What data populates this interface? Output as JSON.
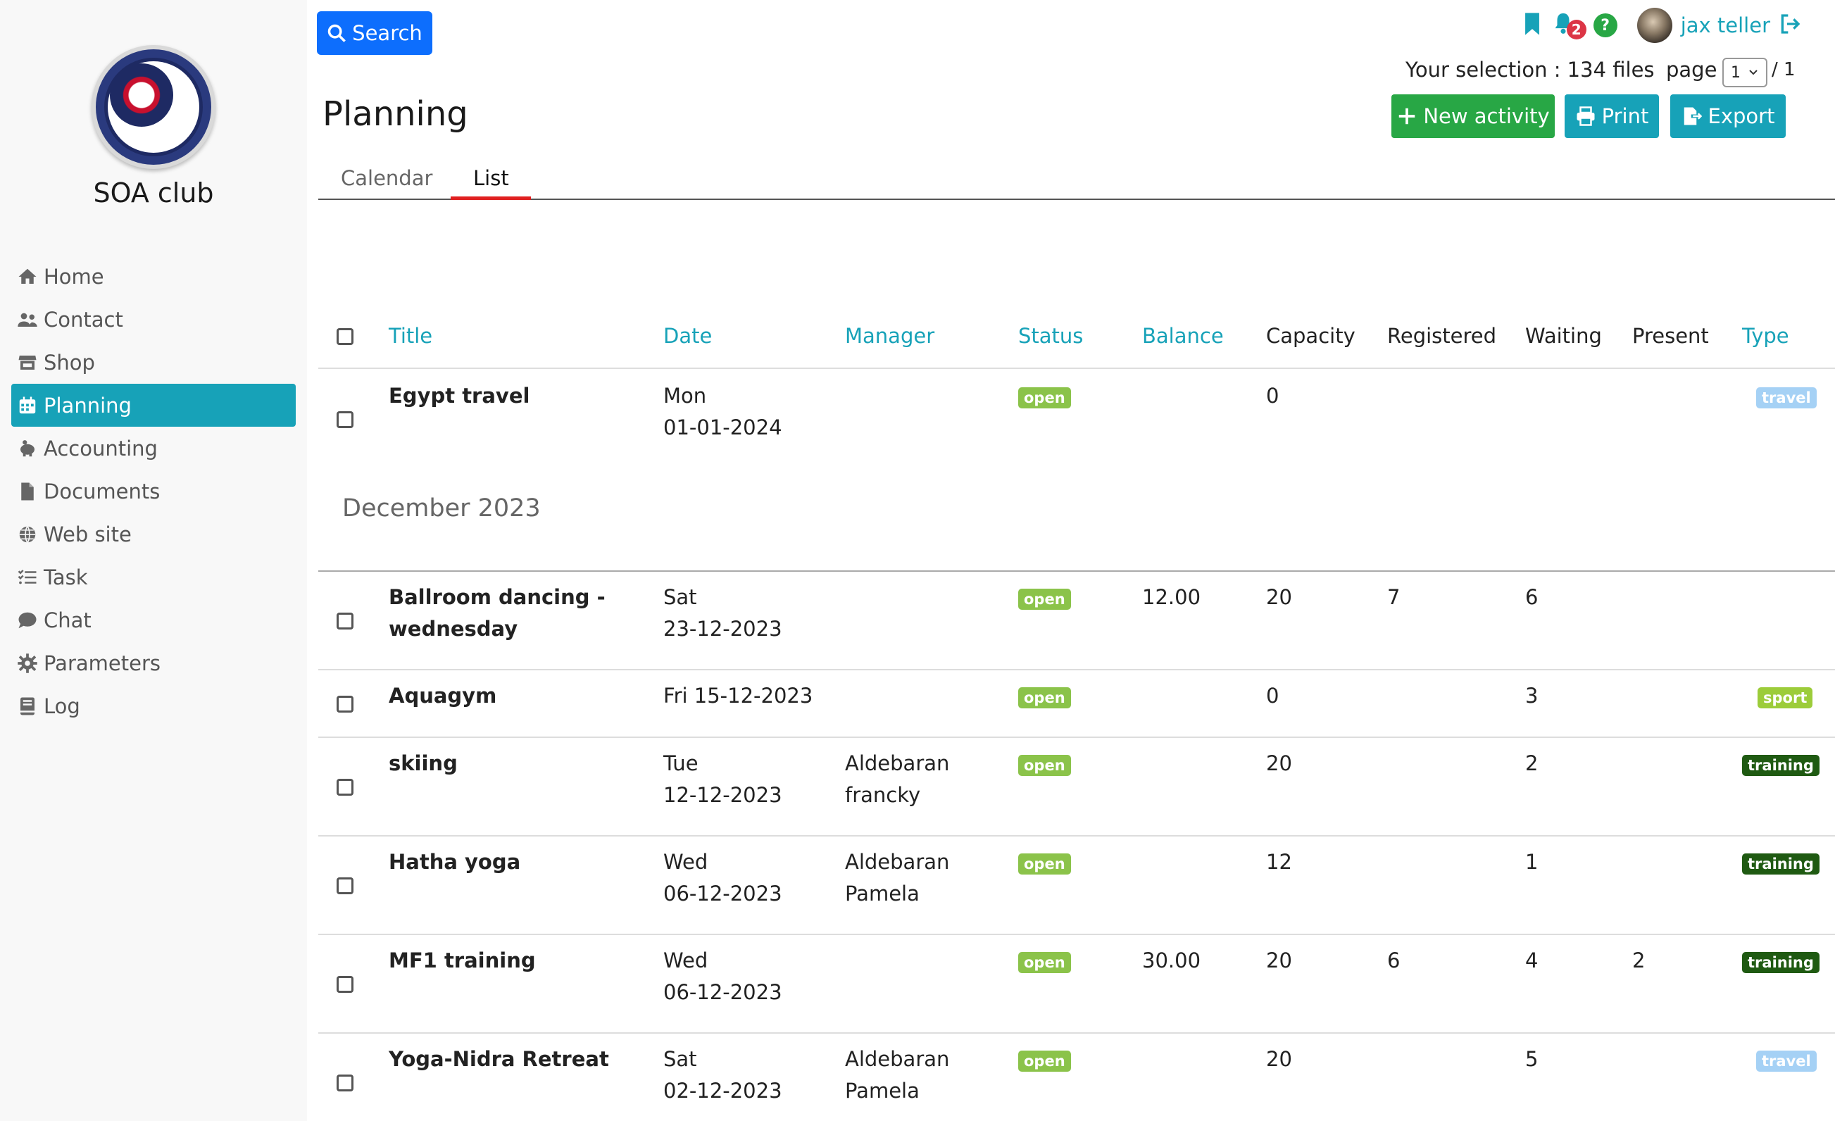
{
  "app": {
    "club_name": "SOA club"
  },
  "sidebar": {
    "items": [
      {
        "label": "Home",
        "icon": "home-icon"
      },
      {
        "label": "Contact",
        "icon": "users-icon"
      },
      {
        "label": "Shop",
        "icon": "store-icon"
      },
      {
        "label": "Planning",
        "icon": "calendar-icon",
        "active": true
      },
      {
        "label": "Accounting",
        "icon": "piggy-bank-icon"
      },
      {
        "label": "Documents",
        "icon": "file-icon"
      },
      {
        "label": "Web site",
        "icon": "globe-icon"
      },
      {
        "label": "Task",
        "icon": "tasks-icon"
      },
      {
        "label": "Chat",
        "icon": "chat-icon"
      },
      {
        "label": "Parameters",
        "icon": "gear-icon"
      },
      {
        "label": "Log",
        "icon": "book-icon"
      }
    ]
  },
  "header": {
    "search_label": "Search",
    "title": "Planning",
    "notifications_count": "2",
    "help_label": "?",
    "username": "jax teller",
    "selection_text": "Your selection : 134 files",
    "page_label": "page",
    "page_value": "1",
    "page_total": "/ 1",
    "new_activity_label": "New activity",
    "print_label": "Print",
    "export_label": "Export"
  },
  "tabs": [
    {
      "label": "Calendar",
      "active": false
    },
    {
      "label": "List",
      "active": true
    }
  ],
  "table": {
    "columns": [
      "Title",
      "Date",
      "Manager",
      "Status",
      "Balance",
      "Capacity",
      "Registered",
      "Waiting",
      "Present",
      "Type"
    ],
    "rows_top": [
      {
        "title": "Egypt travel",
        "date1": "Mon",
        "date2": "01-01-2024",
        "manager1": "",
        "manager2": "",
        "status": "open",
        "balance": "",
        "capacity": "0",
        "registered": "",
        "waiting": "",
        "present": "",
        "type": "travel"
      }
    ],
    "section_label": "December 2023",
    "rows": [
      {
        "title1": "Ballroom dancing -",
        "title2": "wednesday",
        "date1": "Sat",
        "date2": "23-12-2023",
        "manager1": "",
        "manager2": "",
        "status": "open",
        "balance": "12.00",
        "capacity": "20",
        "registered": "7",
        "waiting": "6",
        "present": "",
        "type": ""
      },
      {
        "title1": "Aquagym",
        "title2": "",
        "date1": "Fri 15-12-2023",
        "date2": "",
        "manager1": "",
        "manager2": "",
        "status": "open",
        "balance": "",
        "capacity": "0",
        "registered": "",
        "waiting": "3",
        "present": "",
        "type": "sport"
      },
      {
        "title1": "skiing",
        "title2": "",
        "date1": "Tue",
        "date2": "12-12-2023",
        "manager1": "Aldebaran",
        "manager2": "francky",
        "status": "open",
        "balance": "",
        "capacity": "20",
        "registered": "",
        "waiting": "2",
        "present": "",
        "type": "training"
      },
      {
        "title1": "Hatha yoga",
        "title2": "",
        "date1": "Wed",
        "date2": "06-12-2023",
        "manager1": "Aldebaran",
        "manager2": "Pamela",
        "status": "open",
        "balance": "",
        "capacity": "12",
        "registered": "",
        "waiting": "1",
        "present": "",
        "type": "training"
      },
      {
        "title1": "MF1 training",
        "title2": "",
        "date1": "Wed",
        "date2": "06-12-2023",
        "manager1": "",
        "manager2": "",
        "status": "open",
        "balance": "30.00",
        "capacity": "20",
        "registered": "6",
        "waiting": "4",
        "present": "2",
        "type": "training"
      },
      {
        "title1": "Yoga-Nidra Retreat",
        "title2": "",
        "date1": "Sat",
        "date2": "02-12-2023",
        "manager1": "Aldebaran",
        "manager2": "Pamela",
        "status": "open",
        "balance": "",
        "capacity": "20",
        "registered": "",
        "waiting": "5",
        "present": "",
        "type": "travel"
      }
    ]
  },
  "colors": {
    "accent": "#17a2b8",
    "primary": "#0d6efd",
    "success": "#28a745",
    "danger": "#dc3545",
    "status_open": "#8bc34a",
    "type_travel": "#a5d1f5",
    "type_sport": "#9ccc3a",
    "type_training": "#1f5a12"
  }
}
